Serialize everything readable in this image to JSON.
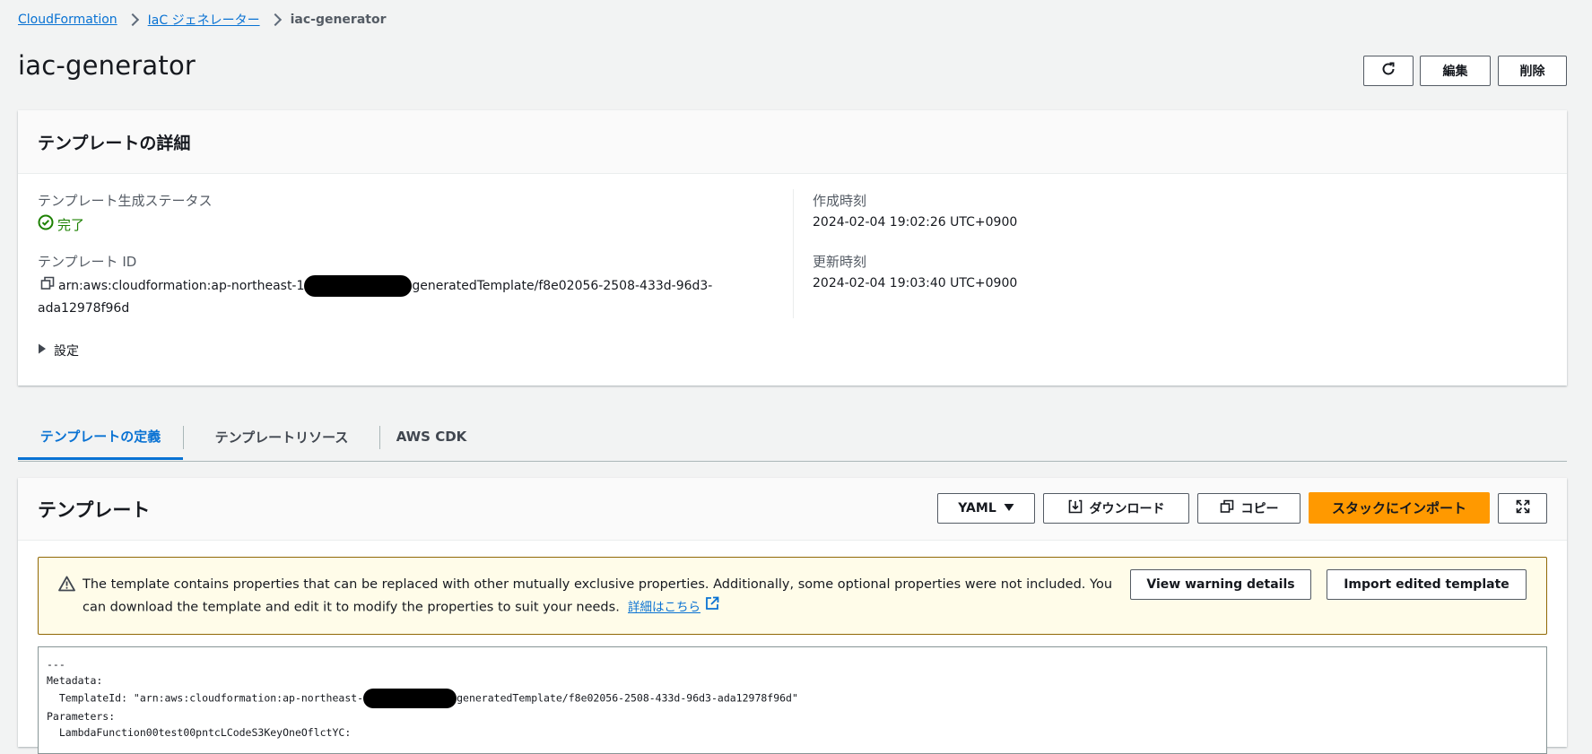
{
  "breadcrumb": {
    "items": [
      "CloudFormation",
      "IaC ジェネレーター"
    ],
    "current": "iac-generator"
  },
  "page_title": "iac-generator",
  "header_buttons": {
    "edit": "編集",
    "delete": "削除"
  },
  "details": {
    "title": "テンプレートの詳細",
    "status_label": "テンプレート生成ステータス",
    "status_value": "完了",
    "id_label": "テンプレート ID",
    "id_prefix": "arn:aws:cloudformation:ap-northeast-1",
    "id_suffix": "generatedTemplate/f8e02056-2508-433d-96d3-",
    "id_suffix2": "ada12978f96d",
    "created_label": "作成時刻",
    "created_value": "2024-02-04 19:02:26 UTC+0900",
    "updated_label": "更新時刻",
    "updated_value": "2024-02-04 19:03:40 UTC+0900",
    "settings_label": "設定"
  },
  "tabs": [
    "テンプレートの定義",
    "テンプレートリソース",
    "AWS CDK"
  ],
  "template": {
    "title": "テンプレート",
    "format": "YAML",
    "download": "ダウンロード",
    "copy": "コピー",
    "import": "スタックにインポート"
  },
  "warning": {
    "text": "The template contains properties that can be replaced with other mutually exclusive properties. Additionally, some optional properties were not included. You can download the template and edit it to modify the properties to suit your needs.",
    "link": "詳細はこちら",
    "view_button": "View warning details",
    "import_button": "Import edited template"
  },
  "code": {
    "line1": "---",
    "line2": "Metadata:",
    "line3_prefix": "  TemplateId: \"arn:aws:cloudformation:ap-northeast-",
    "line3_suffix": "generatedTemplate/f8e02056-2508-433d-96d3-ada12978f96d\"",
    "line4": "Parameters:",
    "line5": "  LambdaFunction00test00pntcLCodeS3KeyOneOflctYC:"
  },
  "colors": {
    "link": "#0972d3",
    "success": "#1d8102",
    "primary": "#ff9900",
    "warning_border": "#906806",
    "warning_bg": "#fffce9"
  },
  "icons": [
    "refresh-icon",
    "status-success-icon",
    "copy-icon",
    "caret-right-icon",
    "caret-down-icon",
    "download-icon",
    "copy-icon",
    "fullscreen-icon",
    "warning-icon",
    "external-link-icon"
  ]
}
